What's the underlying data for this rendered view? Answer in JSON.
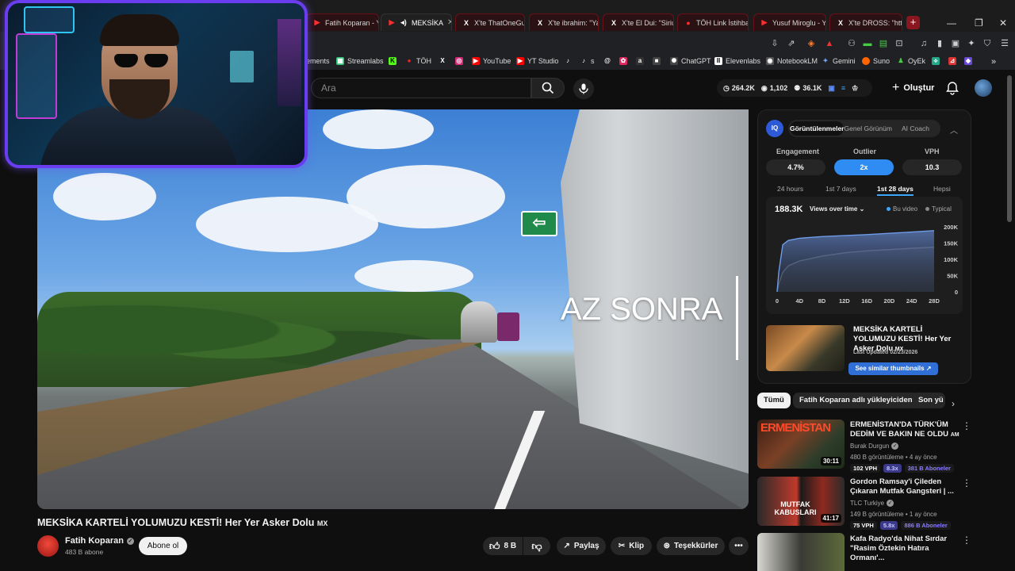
{
  "tabs": [
    {
      "label": "Fatih Koparan - Y",
      "icon": "youtube-icon"
    },
    {
      "label": "MEKSİKA",
      "icon": "youtube-icon",
      "active": true
    },
    {
      "label": "X'te ThatOneGuy",
      "icon": "x-icon"
    },
    {
      "label": "X'te ibrahim: \"Ya",
      "icon": "x-icon"
    },
    {
      "label": "X'te El Dui: \"Sirius",
      "icon": "x-icon"
    },
    {
      "label": "TÖH Link İstihbar",
      "icon": "toh-icon"
    },
    {
      "label": "Yusuf Miroglu - Y",
      "icon": "youtube-icon"
    },
    {
      "label": "X'te DROSS: \"http:",
      "icon": "x-icon"
    }
  ],
  "bookmarks": [
    {
      "label": "ements",
      "icon": ""
    },
    {
      "label": "Streamlabs",
      "icon": "streamlabs-icon"
    },
    {
      "label": "",
      "icon": "kick-icon"
    },
    {
      "label": "TÖH",
      "icon": "toh-icon"
    },
    {
      "label": "",
      "icon": "x-icon"
    },
    {
      "label": "",
      "icon": "instagram-icon"
    },
    {
      "label": "YouTube",
      "icon": "youtube-icon"
    },
    {
      "label": "YT Studio",
      "icon": "yt-studio-icon"
    },
    {
      "label": "",
      "icon": "tiktok-icon"
    },
    {
      "label": "s",
      "icon": "tiktok-icon"
    },
    {
      "label": "",
      "icon": "threads-icon"
    },
    {
      "label": "",
      "icon": "app-icon"
    },
    {
      "label": "",
      "icon": "amazon-icon"
    },
    {
      "label": "",
      "icon": "square-icon"
    },
    {
      "label": "ChatGPT",
      "icon": "chatgpt-icon"
    },
    {
      "label": "Elevenlabs",
      "icon": "elevenlabs-icon"
    },
    {
      "label": "NotebookLM",
      "icon": "notebooklm-icon"
    },
    {
      "label": "Gemini",
      "icon": "gemini-icon"
    },
    {
      "label": "Suno",
      "icon": "suno-icon"
    },
    {
      "label": "OyEk",
      "icon": "oyek-icon"
    }
  ],
  "header": {
    "search_placeholder": "Ara",
    "stats": {
      "views": "264.2K",
      "watching": "1,102",
      "subs": "36.1K"
    },
    "create_label": "Oluştur"
  },
  "video": {
    "overlay_text": "AZ SONRA",
    "title": "MEKSİKA KARTELİ YOLUMUZU KESTİ! Her Yer Asker Dolu",
    "title_suffix": "MX",
    "channel": "Fatih Koparan",
    "subscribers": "483 B abone",
    "subscribe_label": "Abone ol",
    "likes": "8 B",
    "share_label": "Paylaş",
    "clip_label": "Klip",
    "thanks_label": "Teşekkürler"
  },
  "panel": {
    "logo": "IQ",
    "tabs": [
      "Görüntülenmeler",
      "Genel Görünüm",
      "AI Coach"
    ],
    "active_tab": 0,
    "metrics": [
      {
        "label": "Engagement",
        "value": "4.7%"
      },
      {
        "label": "Outlier",
        "value": "2x",
        "highlight": true
      },
      {
        "label": "VPH",
        "value": "10.3"
      }
    ],
    "ranges": [
      "24 hours",
      "1st 7 days",
      "1st 28 days",
      "Hepsi"
    ],
    "active_range": 2,
    "total": "188.3K",
    "chart_selector": "Views over time",
    "legend": [
      {
        "label": "Bu video",
        "color": "#3ea6ff"
      },
      {
        "label": "Typical",
        "color": "#8a8a8a"
      }
    ],
    "thumb_card": {
      "title": "MEKSİKA KARTELİ YOLUMUZU KESTİ! Her Yer Asker Dolu",
      "title_suffix": "MX",
      "date": "Last Updated 02/23/2026",
      "button": "See similar thumbnails"
    }
  },
  "chart_data": {
    "type": "area",
    "title": "",
    "xlabel": "",
    "ylabel": "",
    "x_ticks": [
      "0",
      "4D",
      "8D",
      "12D",
      "16D",
      "20D",
      "24D",
      "28D"
    ],
    "y_ticks": [
      "0",
      "50K",
      "100K",
      "150K",
      "200K"
    ],
    "ylim": [
      0,
      200000
    ],
    "x": [
      0,
      0.3,
      1,
      2,
      4,
      8,
      12,
      16,
      20,
      24,
      28
    ],
    "series": [
      {
        "name": "Bu video",
        "values": [
          0,
          60000,
          145000,
          158000,
          165000,
          170000,
          173000,
          176000,
          180000,
          184000,
          188300
        ]
      },
      {
        "name": "Typical",
        "values": [
          0,
          25000,
          60000,
          80000,
          95000,
          110000,
          120000,
          126000,
          130000,
          134000,
          137000
        ]
      }
    ]
  },
  "chips": [
    "Tümü",
    "Fatih Koparan adlı yükleyiciden",
    "Son yü"
  ],
  "recommendations": [
    {
      "title": "ERMENİSTAN'DA TÜRK'ÜM DEDİM VE BAKIN NE OLDU",
      "title_suffix": "AM",
      "channel": "Burak Durgun",
      "meta": "480 B görüntüleme • 4 ay önce",
      "duration": "30:11",
      "vph": "102 VPH",
      "outlier": "8.3x",
      "subs": "381 B Aboneler",
      "thumb_text": "ERMENİSTAN"
    },
    {
      "title": "Gordon Ramsay'i Çileden Çıkaran Mutfak Gangsteri | ...",
      "title_suffix": "",
      "channel": "TLC Turkiye",
      "meta": "149 B görüntüleme • 1 ay önce",
      "duration": "41:17",
      "vph": "75 VPH",
      "outlier": "5.8x",
      "subs": "886 B Aboneler",
      "thumb_text": "MUTFAK KABUSLARI"
    },
    {
      "title": "Kafa Radyo'da Nihat Sırdar \"Rasim Öztekin Hatıra Ormanı'...",
      "title_suffix": "",
      "channel": "",
      "meta": "",
      "duration": "",
      "vph": "",
      "outlier": "",
      "subs": "",
      "thumb_text": ""
    }
  ]
}
